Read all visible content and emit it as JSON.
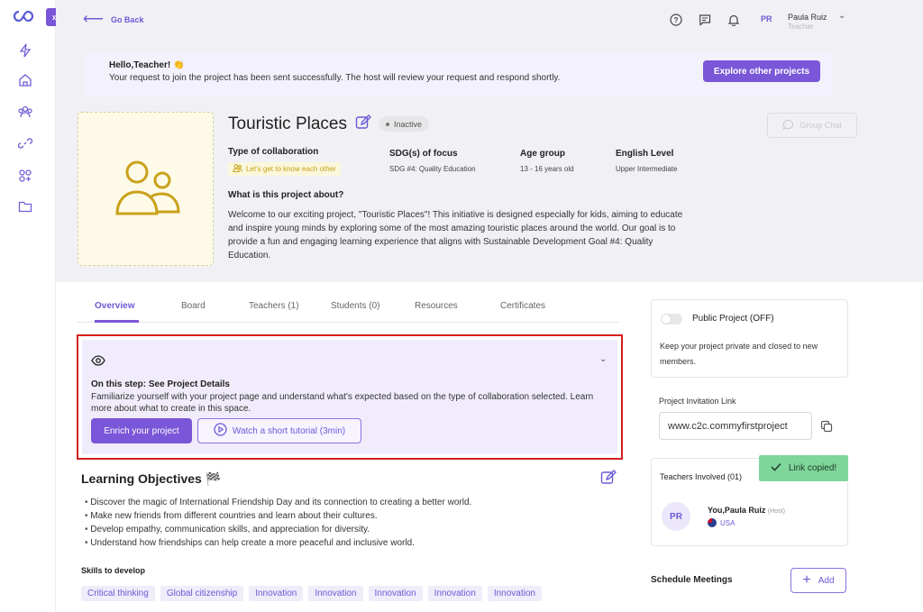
{
  "nav": {
    "back_label": "Go Back"
  },
  "user": {
    "initials": "PR",
    "name": "Paula Ruiz",
    "role": "Teacher"
  },
  "notice": {
    "greeting": "Hello,Teacher! 👏",
    "message": "Your request to join the project has been sent successfully. The host will review your request and respond shortly.",
    "explore_label": "Explore other projects"
  },
  "project": {
    "title": "Touristic Places",
    "status": "Inactive",
    "group_chat_label": "Group Chat",
    "type_label": "Type of collaboration",
    "type_value": "Let's get to know each other",
    "sdg_label": "SDG(s) of focus",
    "sdg_value": "SDG #4: Quality Education",
    "age_label": "Age group",
    "age_value": "13 - 16 years old",
    "english_label": "English Level",
    "english_value": "Upper Intermediate",
    "about_title": "What is this project about?",
    "about_text": "Welcome to our exciting project, \"Touristic Places\"! This initiative is designed especially for kids, aiming to educate and inspire young minds by exploring some of the most amazing touristic places around the world. Our goal is to provide a fun and engaging learning experience that aligns with Sustainable Development Goal #4: Quality Education."
  },
  "tabs": [
    "Overview",
    "Board",
    "Teachers (1)",
    "Students (0)",
    "Resources",
    "Certificates"
  ],
  "step": {
    "title": "On this step: See Project Details",
    "desc": "Familiarize yourself with your project page and understand what's expected based on the type of collaboration selected. Learn more about what to create in this space.",
    "enrich_label": "Enrich your project",
    "tutorial_label": "Watch a short tutorial (3min)"
  },
  "objectives": {
    "title": "Learning Objectives 🏁",
    "items": [
      "Discover the magic of International Friendship Day and its connection to creating a better world.",
      "Make new friends from different countries and learn about their cultures.",
      "Develop empathy, communication skills, and appreciation for diversity.",
      "Understand how friendships can help create a more peaceful and inclusive world."
    ],
    "skills_title": "Skills to develop",
    "skills": [
      "Critical thinking",
      "Global citizenship",
      "Innovation",
      "Innovation",
      "Innovation",
      "Innovation",
      "Innovation"
    ]
  },
  "privacy": {
    "title": "Public Project (OFF)",
    "desc": "Keep your project private and closed to new members."
  },
  "invitation": {
    "label": "Project Invitation Link",
    "value": "www.c2c.commyfirstproject"
  },
  "toast": {
    "message": "Link copied!"
  },
  "teachers": {
    "title": "Teachers Involved (01)",
    "member_initials": "PR",
    "member_name": "You,Paula Ruiz",
    "member_role": "(Host)",
    "member_country": "USA"
  },
  "meetings": {
    "title": "Schedule Meetings",
    "add_label": "Add"
  },
  "colors": {
    "accent": "#7a56d8",
    "toast": "#7fd69a",
    "highlight_border": "#d51e1e"
  }
}
